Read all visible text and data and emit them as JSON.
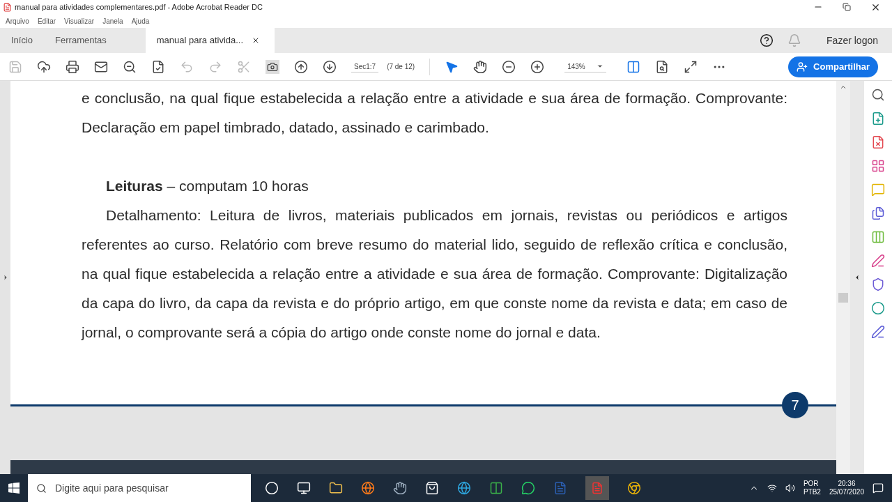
{
  "window": {
    "title": "manual para atividades complementares.pdf - Adobe Acrobat Reader DC"
  },
  "menu": [
    "Arquivo",
    "Editar",
    "Visualizar",
    "Janela",
    "Ajuda"
  ],
  "tabs": [
    {
      "label": "Início",
      "selected": false,
      "closable": false
    },
    {
      "label": "Ferramentas",
      "selected": false,
      "closable": false
    },
    {
      "label": "manual para ativida...",
      "selected": true,
      "closable": true
    }
  ],
  "account": {
    "login": "Fazer logon"
  },
  "toolbar": {
    "page_label": "Sec1:7",
    "page_count": "(7 de 12)",
    "zoom": "143%",
    "share": "Compartilhar"
  },
  "document": {
    "paragraphs": [
      {
        "kind": "body",
        "indent": false,
        "text": "e conclusão, na qual fique estabelecida a relação entre a atividade e sua área de formação. Comprovante: Declaração em papel timbrado, datado, assinado e carimbado."
      },
      {
        "kind": "heading",
        "indent": true,
        "text": "**Leituras** – computam 10 horas"
      },
      {
        "kind": "body",
        "indent": true,
        "text": "Detalhamento: Leitura de livros, materiais publicados em jornais, revistas ou periódicos e artigos referentes ao curso. Relatório com breve resumo do material lido, seguido de reflexão crítica e conclusão, na qual fique estabelecida a relação entre a atividade e sua área de formação. Comprovante: Digitalização da capa do livro, da capa da revista e do próprio artigo, em que conste nome da revista e data; em caso de jornal, o comprovante será a cópia do artigo onde conste nome do jornal e data."
      }
    ],
    "page_number": "7"
  },
  "taskbar": {
    "search_placeholder": "Digite aqui para pesquisar",
    "tray": {
      "language": "POR",
      "layout": "PTB2",
      "time": "20:36",
      "date": "25/07/2020"
    }
  }
}
